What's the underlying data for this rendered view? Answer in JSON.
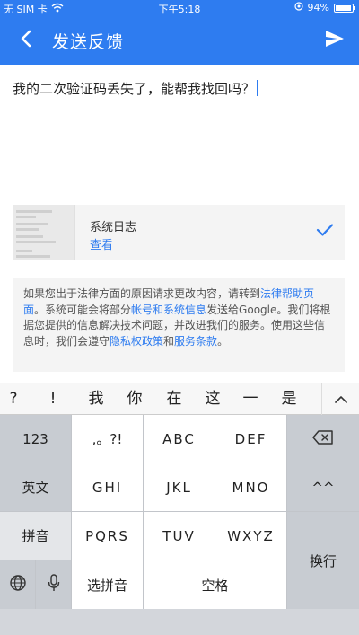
{
  "status_bar": {
    "carrier": "无 SIM 卡",
    "time": "下午5:18",
    "battery_percent": "94%",
    "battery_level": 0.94
  },
  "app_bar": {
    "title": "发送反馈",
    "back_icon": "arrow-back-icon",
    "send_icon": "send-icon"
  },
  "compose": {
    "text": "我的二次验证码丢失了，能帮我找回吗？"
  },
  "system_log": {
    "title": "系统日志",
    "view_link": "查看",
    "included": true,
    "check_icon": "check-icon"
  },
  "legal": {
    "p1": "如果您出于法律方面的原因请求更改内容，请转到",
    "link_help": "法律帮助页面",
    "p2": "。系统可能会将部分",
    "link_account": "帐号和系统信息",
    "p3": "发送给Google。我们将根据您提供的信息解决技术问题，并改进我们的服务。使用这些信息时，我们会遵守",
    "link_privacy": "隐私权政策",
    "p4": "和",
    "link_terms": "服务条款",
    "p5": "。"
  },
  "keyboard": {
    "candidates": [
      "?",
      "!",
      "我",
      "你",
      "在",
      "这",
      "一",
      "是"
    ],
    "collapse_icon": "chevron-up-icon",
    "rows": {
      "r1": [
        "123",
        ",。?!",
        "ABC",
        "DEF"
      ],
      "r2": [
        "英文",
        "GHI",
        "JKL",
        "MNO",
        "^^"
      ],
      "r3": [
        "拼音",
        "PQRS",
        "TUV",
        "WXYZ"
      ],
      "r4": [
        "选拼音",
        "空格"
      ]
    },
    "enter_label": "换行",
    "delete_icon": "backspace-icon",
    "globe_icon": "globe-icon",
    "mic_icon": "microphone-icon"
  },
  "colors": {
    "accent": "#2e7cf0",
    "keyboard_bg": "#d3d6db",
    "key_light": "#ffffff",
    "key_dark": "#c8ccd2"
  }
}
